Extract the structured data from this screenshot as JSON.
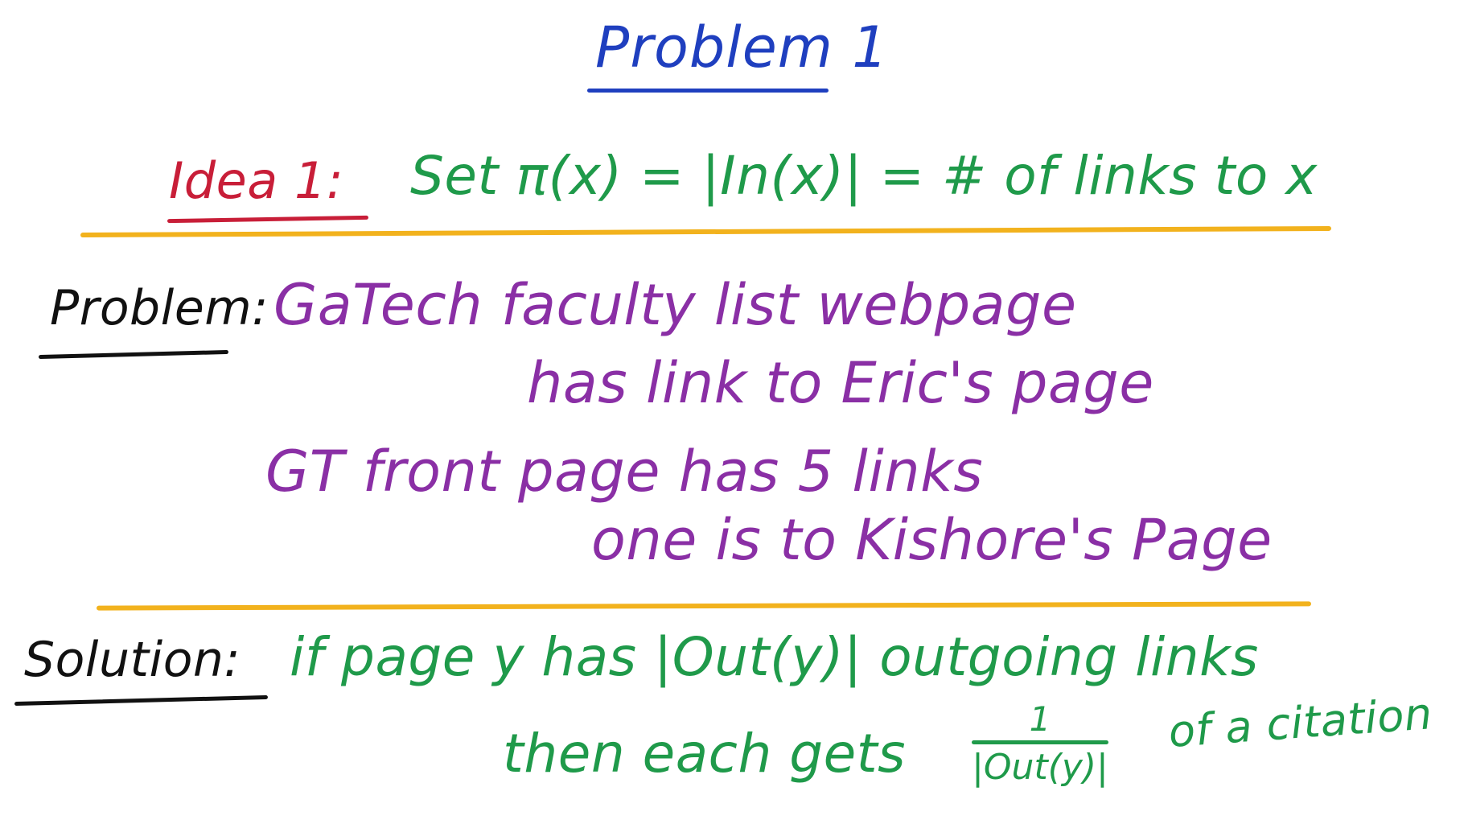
{
  "title": "Problem 1",
  "idea": {
    "label": "Idea 1:",
    "text": "Set π(x) = |In(x)| = # of links to x"
  },
  "problem": {
    "label": "Problem:",
    "lines": [
      "GaTech faculty list webpage",
      "has link to Eric's page",
      "GT front page has 5 links",
      "one is to Kishore's Page"
    ]
  },
  "solution": {
    "label": "Solution:",
    "line1": "if page y has |Out(y)| outgoing links",
    "line2_prefix": "then each gets",
    "fraction_numerator": "1",
    "fraction_denominator": "|Out(y)|",
    "line2_suffix": "of a citation"
  },
  "colors": {
    "title": "#1f3fbf",
    "idea_label": "#c81e38",
    "green_text": "#1f9a4a",
    "purple_text": "#8a2fa5",
    "separator": "#f2b21d",
    "section_label": "#111111"
  }
}
